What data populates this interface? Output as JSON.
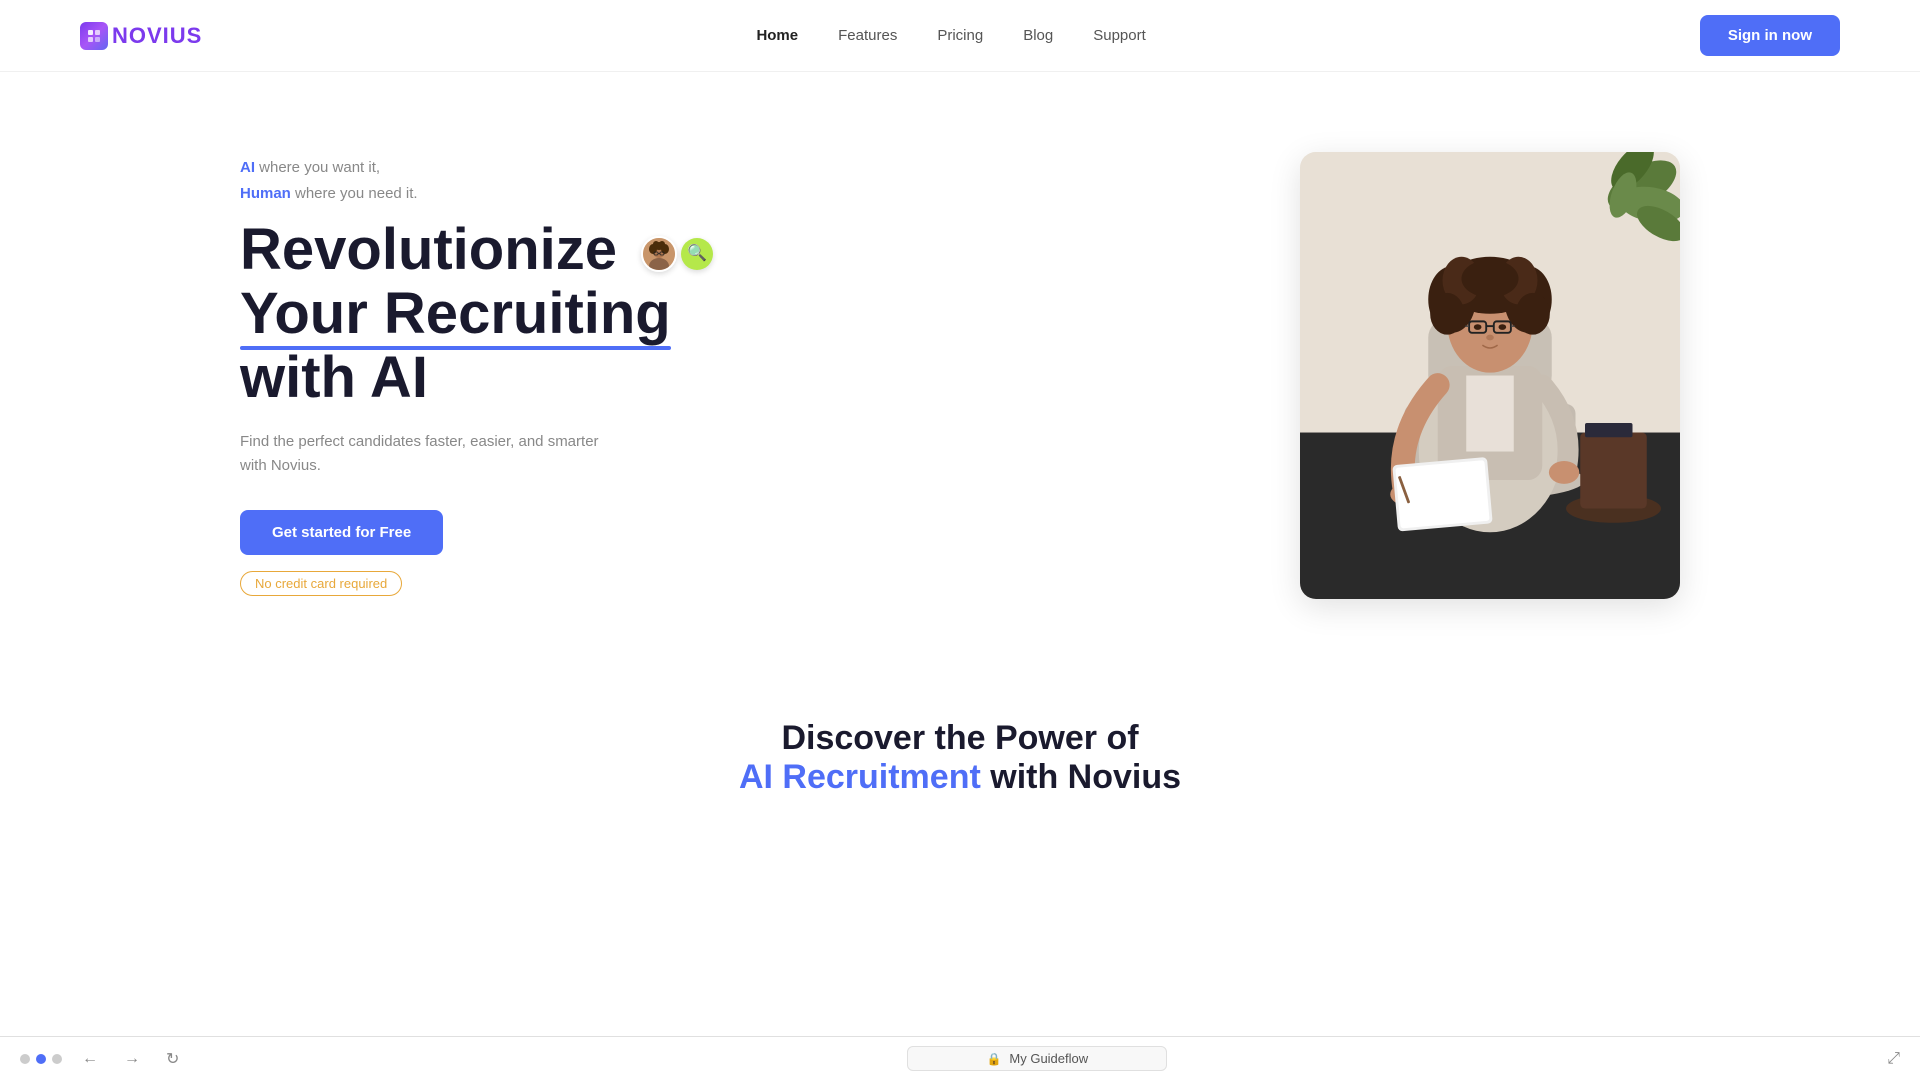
{
  "brand": {
    "name": "NOVIUS",
    "logo_icon": "◈"
  },
  "nav": {
    "links": [
      {
        "id": "home",
        "label": "Home",
        "active": true
      },
      {
        "id": "features",
        "label": "Features",
        "active": false
      },
      {
        "id": "pricing",
        "label": "Pricing",
        "active": false
      },
      {
        "id": "blog",
        "label": "Blog",
        "active": false
      },
      {
        "id": "support",
        "label": "Support",
        "active": false
      }
    ],
    "cta_label": "Sign in now"
  },
  "hero": {
    "tagline_ai": "AI",
    "tagline_ai_suffix": " where you want it,",
    "tagline_human": "Human",
    "tagline_human_suffix": " where you need it.",
    "headline_part1": "Revolutionize",
    "headline_part2": "Your Recruiting",
    "headline_part3": "with AI",
    "description": "Find the perfect candidates faster, easier, and smarter with Novius.",
    "cta_label": "Get started for Free",
    "no_cc_label": "No credit card required"
  },
  "discover": {
    "line1": "Discover the Power of",
    "line2_blue": "AI Recruitment",
    "line2_suffix": " with Novius"
  },
  "bottom_bar": {
    "dots": [
      {
        "active": true
      },
      {
        "active": true
      },
      {
        "active": false
      }
    ],
    "guideflow_label": "My Guideflow",
    "lock_icon": "🔒"
  }
}
